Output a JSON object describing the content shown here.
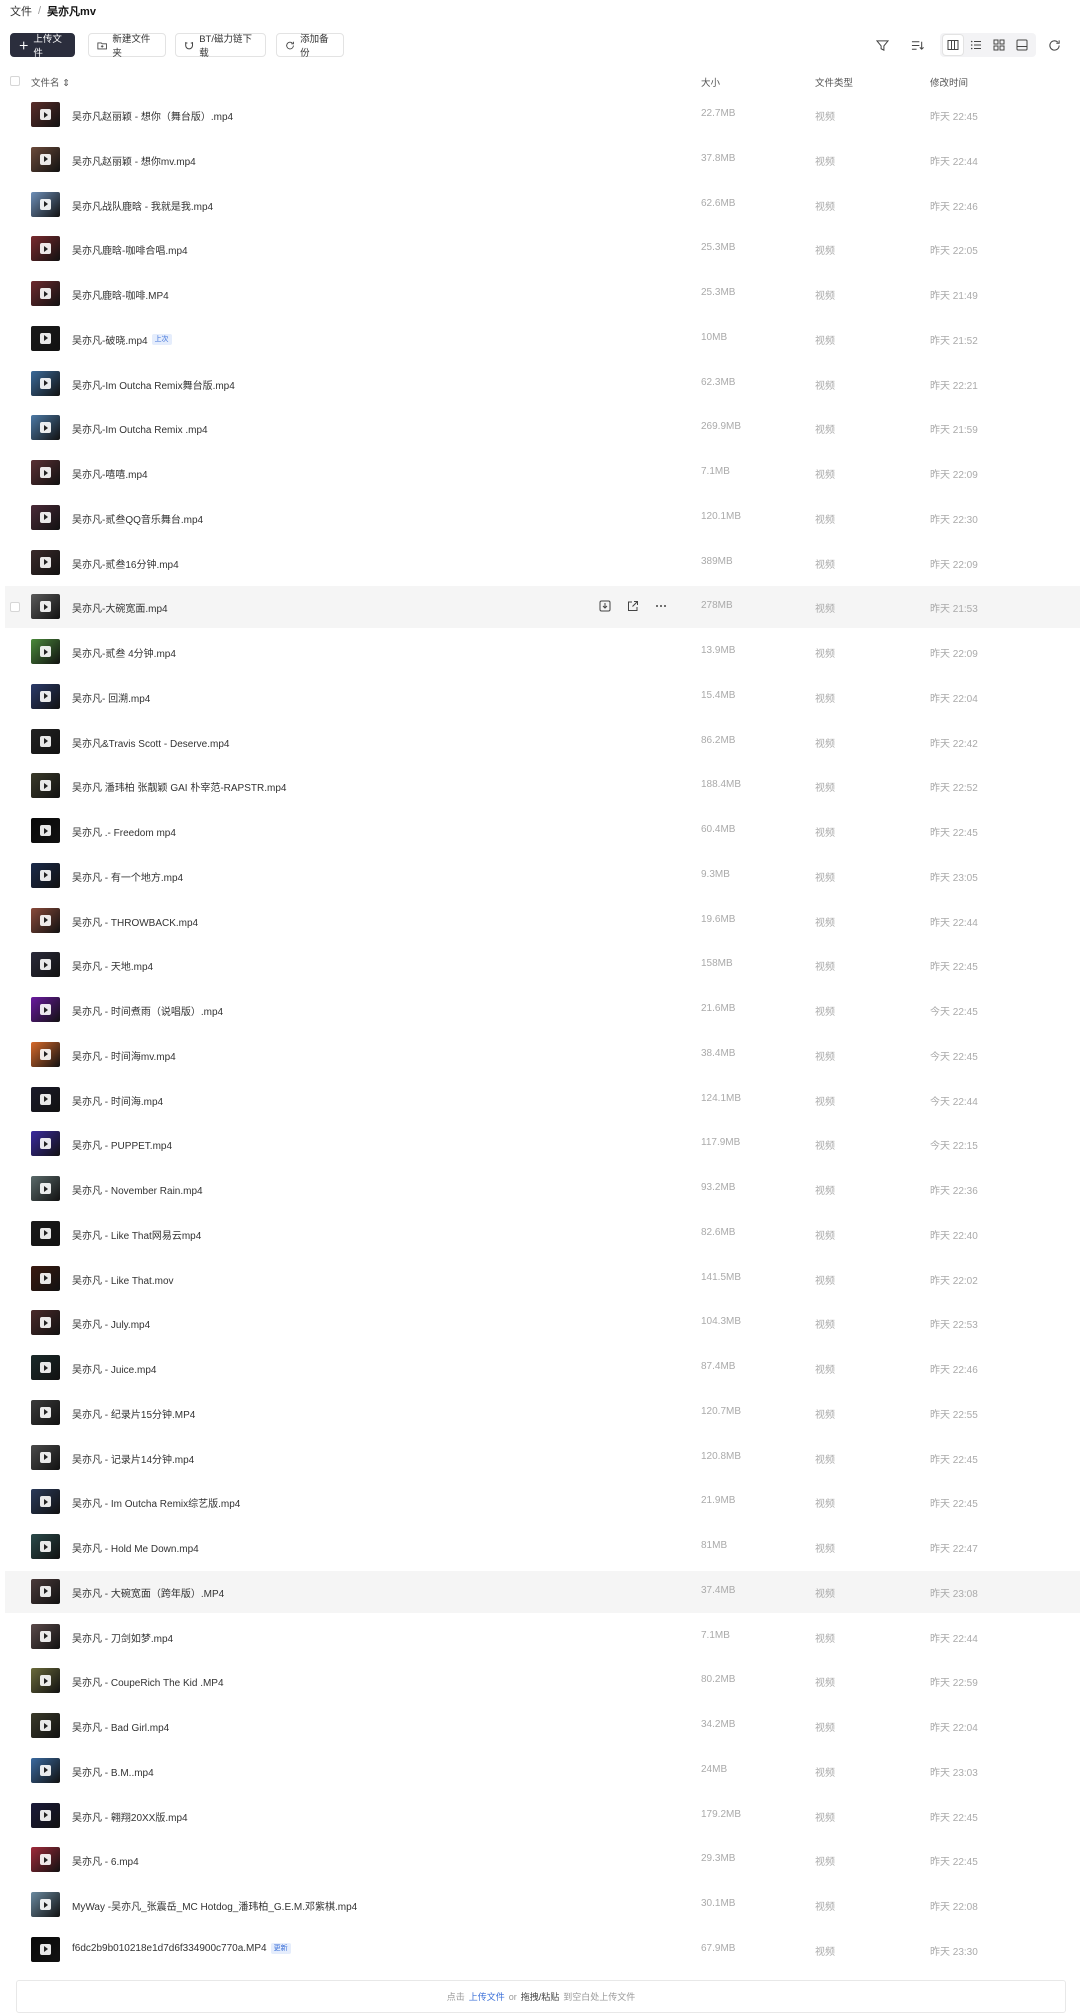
{
  "breadcrumb": {
    "root": "文件",
    "separator": "/",
    "current": "吴亦凡mv"
  },
  "toolbar": {
    "upload_label": "上传文件",
    "new_folder_label": "新建文件夹",
    "bt_label": "BT/磁力链下载",
    "backup_label": "添加备份"
  },
  "table_header": {
    "name": "文件名",
    "size": "大小",
    "type": "文件类型",
    "modified": "修改时间"
  },
  "files": [
    {
      "name": "吴亦凡赵丽颖 - 想你（舞台版）.mp4",
      "size": "22.7MB",
      "type": "视频",
      "modified": "昨天 22:45",
      "badge": "",
      "thumb": "#5a2e2a"
    },
    {
      "name": "吴亦凡赵丽颖 - 想你mv.mp4",
      "size": "37.8MB",
      "type": "视频",
      "modified": "昨天 22:44",
      "badge": "",
      "thumb": "#6b4a3a"
    },
    {
      "name": "吴亦凡战队鹿晗 - 我就是我.mp4",
      "size": "62.6MB",
      "type": "视频",
      "modified": "昨天 22:46",
      "badge": "",
      "thumb": "#6d8fb8"
    },
    {
      "name": "吴亦凡鹿晗-咖啡合唱.mp4",
      "size": "25.3MB",
      "type": "视频",
      "modified": "昨天 22:05",
      "badge": "",
      "thumb": "#7a2a2e"
    },
    {
      "name": "吴亦凡鹿晗-咖啡.MP4",
      "size": "25.3MB",
      "type": "视频",
      "modified": "昨天 21:49",
      "badge": "",
      "thumb": "#6e2a2e"
    },
    {
      "name": "吴亦凡-破晓.mp4",
      "size": "10MB",
      "type": "视频",
      "modified": "昨天 21:52",
      "badge": "上次",
      "thumb": "#1a1a1a"
    },
    {
      "name": "吴亦凡-Im Outcha Remix舞台版.mp4",
      "size": "62.3MB",
      "type": "视频",
      "modified": "昨天 22:21",
      "badge": "",
      "thumb": "#3a6a9a"
    },
    {
      "name": "吴亦凡-Im Outcha Remix .mp4",
      "size": "269.9MB",
      "type": "视频",
      "modified": "昨天 21:59",
      "badge": "",
      "thumb": "#4c7aa6"
    },
    {
      "name": "吴亦凡-嘻嘻.mp4",
      "size": "7.1MB",
      "type": "视频",
      "modified": "昨天 22:09",
      "badge": "",
      "thumb": "#5a3034"
    },
    {
      "name": "吴亦凡-贰叁QQ音乐舞台.mp4",
      "size": "120.1MB",
      "type": "视频",
      "modified": "昨天 22:30",
      "badge": "",
      "thumb": "#4a2a38"
    },
    {
      "name": "吴亦凡-贰叁16分钟.mp4",
      "size": "389MB",
      "type": "视频",
      "modified": "昨天 22:09",
      "badge": "",
      "thumb": "#3a2a2a"
    },
    {
      "name": "吴亦凡-大碗宽面.mp4",
      "size": "278MB",
      "type": "视频",
      "modified": "昨天 21:53",
      "badge": "",
      "thumb": "#5a5a5a"
    },
    {
      "name": "吴亦凡-贰叁 4分钟.mp4",
      "size": "13.9MB",
      "type": "视频",
      "modified": "昨天 22:09",
      "badge": "",
      "thumb": "#4a8a3a"
    },
    {
      "name": "吴亦凡- 回溯.mp4",
      "size": "15.4MB",
      "type": "视频",
      "modified": "昨天 22:04",
      "badge": "",
      "thumb": "#2a3a6a"
    },
    {
      "name": "吴亦凡&Travis Scott - Deserve.mp4",
      "size": "86.2MB",
      "type": "视频",
      "modified": "昨天 22:42",
      "badge": "",
      "thumb": "#222222"
    },
    {
      "name": "吴亦凡 潘玮柏 张靓颖 GAI 朴宰范-RAPSTR.mp4",
      "size": "188.4MB",
      "type": "视频",
      "modified": "昨天 22:52",
      "badge": "",
      "thumb": "#3a3a2a"
    },
    {
      "name": "吴亦凡 .- Freedom mp4",
      "size": "60.4MB",
      "type": "视频",
      "modified": "昨天 22:45",
      "badge": "",
      "thumb": "#0a0a0a"
    },
    {
      "name": "吴亦凡 - 有一个地方.mp4",
      "size": "9.3MB",
      "type": "视频",
      "modified": "昨天 23:05",
      "badge": "",
      "thumb": "#1a2a4a"
    },
    {
      "name": "吴亦凡 - THROWBACK.mp4",
      "size": "19.6MB",
      "type": "视频",
      "modified": "昨天 22:44",
      "badge": "",
      "thumb": "#8a4a3a"
    },
    {
      "name": "吴亦凡 - 天地.mp4",
      "size": "158MB",
      "type": "视频",
      "modified": "昨天 22:45",
      "badge": "",
      "thumb": "#2a2a3a"
    },
    {
      "name": "吴亦凡 - 时间煮雨（说唱版）.mp4",
      "size": "21.6MB",
      "type": "视频",
      "modified": "今天 22:45",
      "badge": "",
      "thumb": "#6a1aa0"
    },
    {
      "name": "吴亦凡 - 时间海mv.mp4",
      "size": "38.4MB",
      "type": "视频",
      "modified": "今天 22:45",
      "badge": "",
      "thumb": "#d86a2a"
    },
    {
      "name": "吴亦凡 - 时间海.mp4",
      "size": "124.1MB",
      "type": "视频",
      "modified": "今天 22:44",
      "badge": "",
      "thumb": "#1a1a2a"
    },
    {
      "name": "吴亦凡 - PUPPET.mp4",
      "size": "117.9MB",
      "type": "视频",
      "modified": "今天 22:15",
      "badge": "",
      "thumb": "#3a2aa0"
    },
    {
      "name": "吴亦凡 - November Rain.mp4",
      "size": "93.2MB",
      "type": "视频",
      "modified": "昨天 22:36",
      "badge": "",
      "thumb": "#5a6a6a"
    },
    {
      "name": "吴亦凡 - Like That网易云mp4",
      "size": "82.6MB",
      "type": "视频",
      "modified": "昨天 22:40",
      "badge": "",
      "thumb": "#1a1a1a"
    },
    {
      "name": "吴亦凡 - Like That.mov",
      "size": "141.5MB",
      "type": "视频",
      "modified": "昨天 22:02",
      "badge": "",
      "thumb": "#3a1a10"
    },
    {
      "name": "吴亦凡 - July.mp4",
      "size": "104.3MB",
      "type": "视频",
      "modified": "昨天 22:53",
      "badge": "",
      "thumb": "#4a2a2a"
    },
    {
      "name": "吴亦凡 - Juice.mp4",
      "size": "87.4MB",
      "type": "视频",
      "modified": "昨天 22:46",
      "badge": "",
      "thumb": "#1a2a2a"
    },
    {
      "name": "吴亦凡 - 纪录片15分钟.MP4",
      "size": "120.7MB",
      "type": "视频",
      "modified": "昨天 22:55",
      "badge": "",
      "thumb": "#3a3a3a"
    },
    {
      "name": "吴亦凡 - 记录片14分钟.mp4",
      "size": "120.8MB",
      "type": "视频",
      "modified": "昨天 22:45",
      "badge": "",
      "thumb": "#4a4a4a"
    },
    {
      "name": "吴亦凡 - Im Outcha Remix综艺版.mp4",
      "size": "21.9MB",
      "type": "视频",
      "modified": "昨天 22:45",
      "badge": "",
      "thumb": "#2a3a5a"
    },
    {
      "name": "吴亦凡 - Hold Me Down.mp4",
      "size": "81MB",
      "type": "视频",
      "modified": "昨天 22:47",
      "badge": "",
      "thumb": "#2a4a4a"
    },
    {
      "name": "吴亦凡 - 大碗宽面（跨年版）.MP4",
      "size": "37.4MB",
      "type": "视频",
      "modified": "昨天 23:08",
      "badge": "",
      "thumb": "#4a3a3a"
    },
    {
      "name": "吴亦凡 - 刀剑如梦.mp4",
      "size": "7.1MB",
      "type": "视频",
      "modified": "昨天 22:44",
      "badge": "",
      "thumb": "#5a4a4a"
    },
    {
      "name": "吴亦凡 - CoupeRich The Kid .MP4",
      "size": "80.2MB",
      "type": "视频",
      "modified": "昨天 22:59",
      "badge": "",
      "thumb": "#6a6a3a"
    },
    {
      "name": "吴亦凡 - Bad Girl.mp4",
      "size": "34.2MB",
      "type": "视频",
      "modified": "昨天 22:04",
      "badge": "",
      "thumb": "#3a3a2a"
    },
    {
      "name": "吴亦凡 - B.M..mp4",
      "size": "24MB",
      "type": "视频",
      "modified": "昨天 23:03",
      "badge": "",
      "thumb": "#3a6aa0"
    },
    {
      "name": "吴亦凡 - 翱翔20XX版.mp4",
      "size": "179.2MB",
      "type": "视频",
      "modified": "昨天 22:45",
      "badge": "",
      "thumb": "#1a1a3a"
    },
    {
      "name": "吴亦凡 - 6.mp4",
      "size": "29.3MB",
      "type": "视频",
      "modified": "昨天 22:45",
      "badge": "",
      "thumb": "#a02a3a"
    },
    {
      "name": "MyWay -吴亦凡_张震岳_MC Hotdog_潘玮柏_G.E.M.邓紫棋.mp4",
      "size": "30.1MB",
      "type": "视频",
      "modified": "昨天 22:08",
      "badge": "",
      "thumb": "#6a8aa0"
    },
    {
      "name": "f6dc2b9b010218e1d7d6f334900c770a.MP4",
      "size": "67.9MB",
      "type": "视频",
      "modified": "昨天 23:30",
      "badge": "更新",
      "thumb": "#0a0a0a"
    }
  ],
  "footer": {
    "prefix": "点击",
    "upload_link": "上传文件",
    "or": "or",
    "drag_text": "拖拽/粘贴",
    "suffix": "到空白处上传文件"
  }
}
